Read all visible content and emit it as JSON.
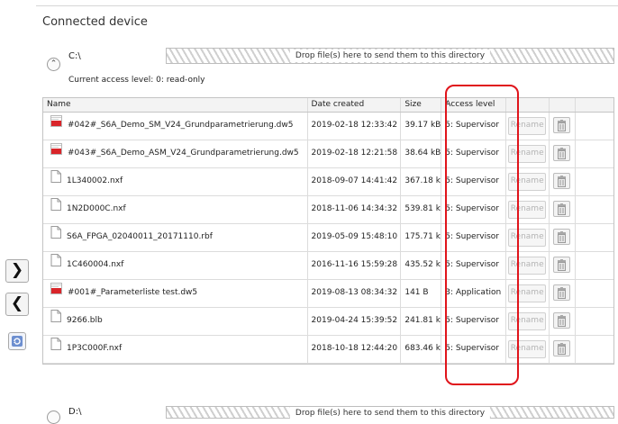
{
  "section_title": "Connected device",
  "drive_c": {
    "path": "C:\\",
    "access_label": "Current access level:  0: read-only",
    "drop_text": "Drop file(s) here to send them to this directory"
  },
  "columns": [
    "Name",
    "Date created",
    "Size",
    "Access level"
  ],
  "rename_label": "Rename",
  "files": [
    {
      "icon": "keb-file-icon",
      "name": "#042#_S6A_Demo_SM_V24_Grundparametrierung.dw5",
      "date": "2019-02-18 12:33:42",
      "size": "39.17 kB",
      "access": "5: Supervisor"
    },
    {
      "icon": "keb-file-icon",
      "name": "#043#_S6A_Demo_ASM_V24_Grundparametrierung.dw5",
      "date": "2019-02-18 12:21:58",
      "size": "38.64 kB",
      "access": "5: Supervisor"
    },
    {
      "icon": "file-icon",
      "name": "1L340002.nxf",
      "date": "2018-09-07 14:41:42",
      "size": "367.18 kB",
      "access": "5: Supervisor"
    },
    {
      "icon": "file-icon",
      "name": "1N2D000C.nxf",
      "date": "2018-11-06 14:34:32",
      "size": "539.81 kB",
      "access": "5: Supervisor"
    },
    {
      "icon": "file-icon",
      "name": "S6A_FPGA_02040011_20171110.rbf",
      "date": "2019-05-09 15:48:10",
      "size": "175.71 kB",
      "access": "5: Supervisor"
    },
    {
      "icon": "file-icon",
      "name": "1C460004.nxf",
      "date": "2016-11-16 15:59:28",
      "size": "435.52 kB",
      "access": "5: Supervisor"
    },
    {
      "icon": "keb-file-icon",
      "name": "#001#_Parameterliste test.dw5",
      "date": "2019-08-13 08:34:32",
      "size": "141 B",
      "access": "3: Application"
    },
    {
      "icon": "file-icon",
      "name": "9266.blb",
      "date": "2019-04-24 15:39:52",
      "size": "241.81 kB",
      "access": "5: Supervisor"
    },
    {
      "icon": "file-icon",
      "name": "1P3C000F.nxf",
      "date": "2018-10-18 12:44:20",
      "size": "683.46 kB",
      "access": "5: Supervisor"
    }
  ],
  "drive_d": {
    "path": "D:\\",
    "drop_text": "Drop file(s) here to send them to this directory"
  },
  "nav": {
    "send_right": "❯",
    "send_left": "❮",
    "collapse": "⌃"
  },
  "colors": {
    "highlight": "#e0141b",
    "keb_icon": "#d9252a",
    "dropzone_hatch": "#cfcfcf"
  }
}
